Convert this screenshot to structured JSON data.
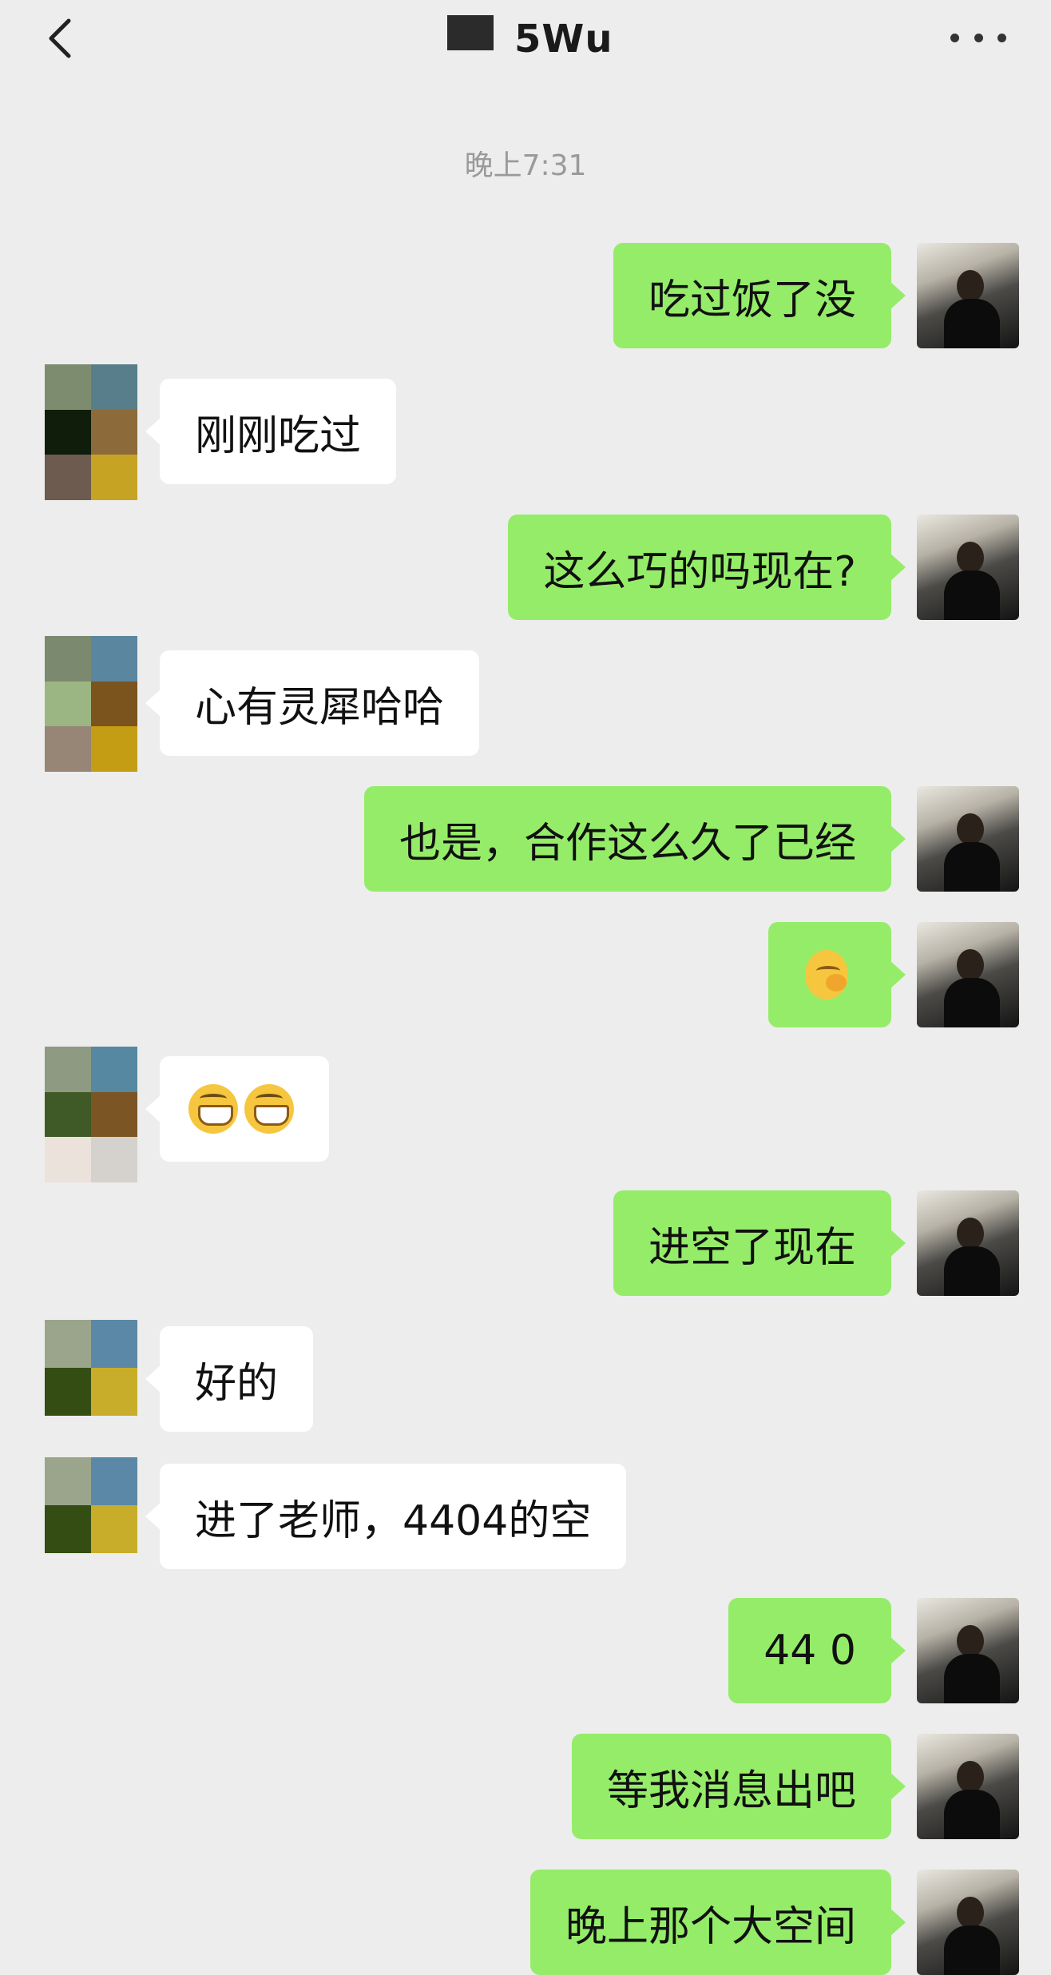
{
  "header": {
    "back_icon": "chevron-left-icon",
    "title": "5Wu",
    "more_icon": "more-horizontal-icon"
  },
  "timestamp": "晚上7:31",
  "messages": [
    {
      "side": "out",
      "text": "吃过饭了没"
    },
    {
      "side": "in",
      "text": "刚刚吃过"
    },
    {
      "side": "out",
      "text": "这么巧的吗现在?"
    },
    {
      "side": "in",
      "text": "心有灵犀哈哈"
    },
    {
      "side": "out",
      "text": "也是，合作这么久了已经"
    },
    {
      "side": "out",
      "emoji": "hugging-face-emoji"
    },
    {
      "side": "in",
      "emoji": "grinning-face-emoji"
    },
    {
      "side": "out",
      "text": "进空了现在"
    },
    {
      "side": "in",
      "text": "好的"
    },
    {
      "side": "in",
      "text": "进了老师，4404的空"
    },
    {
      "side": "out",
      "text": "44 0"
    },
    {
      "side": "out",
      "text": "等我消息出吧"
    },
    {
      "side": "out",
      "text": "晚上那个大空间"
    }
  ],
  "colors": {
    "background": "#ededed",
    "outgoing_bubble": "#95ec69",
    "incoming_bubble": "#ffffff",
    "timestamp": "#9a9a9a"
  }
}
